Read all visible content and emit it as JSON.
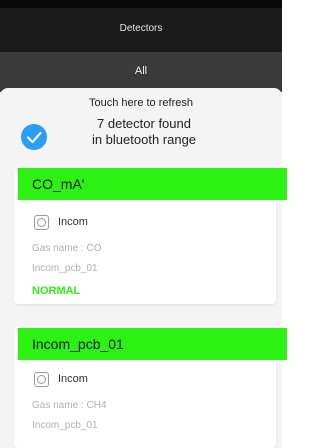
{
  "header": {
    "title": "Detectors"
  },
  "filter": {
    "label": "All"
  },
  "refresh": {
    "label": "Touch here to refresh"
  },
  "status": {
    "line1": "7 detector found",
    "line2": "in bluetooth range"
  },
  "colors": {
    "header_green": "#2cf214",
    "accent_blue": "#2a9df4"
  },
  "detectors": [
    {
      "name": "CO_mA'",
      "brand": "Incom",
      "gas": "Gas name : CO",
      "pcb": "Incom_pcb_01",
      "state": "NORMAL"
    },
    {
      "name": "Incom_pcb_01",
      "brand": "Incom",
      "gas": "Gas name : CH4",
      "pcb": "Incom_pcb_01"
    }
  ]
}
